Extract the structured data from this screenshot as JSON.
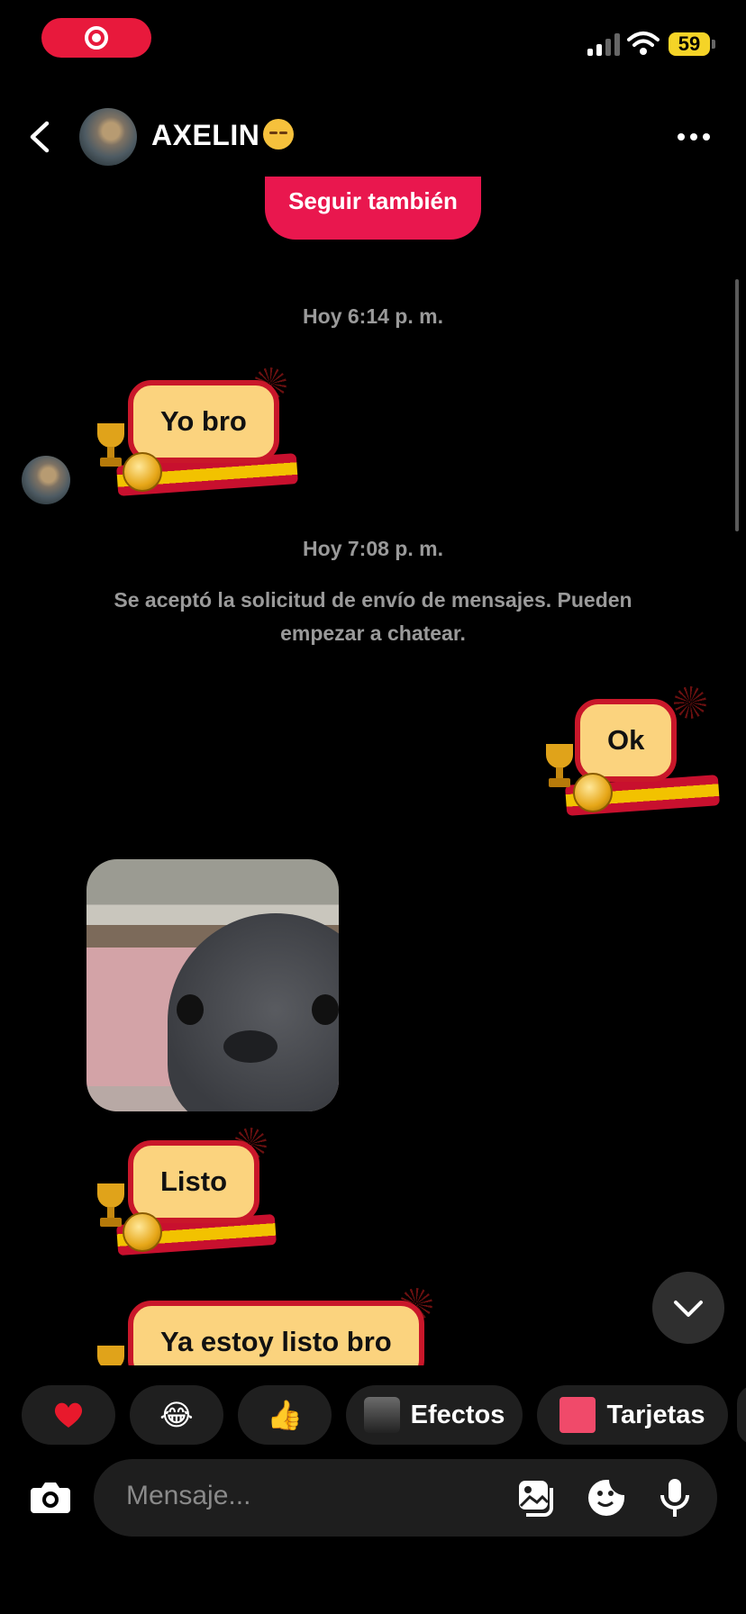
{
  "status": {
    "battery": "59"
  },
  "header": {
    "contact_name": "AXELIN"
  },
  "follow_button": {
    "label": "Seguir también"
  },
  "messages": {
    "ts1": "Hoy 6:14 p. m.",
    "m1": "Yo bro",
    "ts2": "Hoy 7:08 p. m.",
    "system": "Se aceptó la solicitud de envío de mensajes. Pueden empezar a chatear.",
    "m2": "Ok",
    "m3": "Listo",
    "m4": "Ya estoy listo bro"
  },
  "quick_reactions": {
    "heart": "❤️",
    "laugh": "😂",
    "thumbs": "👍",
    "effects": "Efectos",
    "cards": "Tarjetas"
  },
  "composer": {
    "placeholder": "Mensaje..."
  },
  "colors": {
    "accent": "#e9174e",
    "bubble": "#fbd37e",
    "bubble_border": "#c9172a"
  }
}
